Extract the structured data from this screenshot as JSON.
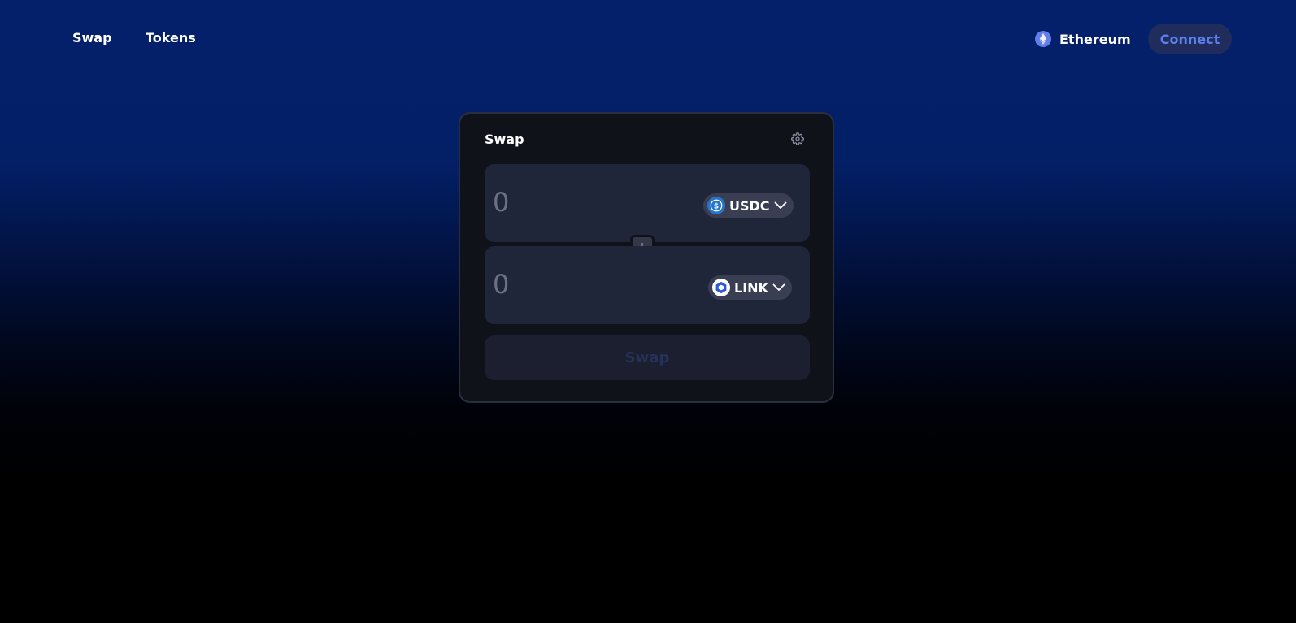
{
  "nav": {
    "items": [
      {
        "label": "Swap"
      },
      {
        "label": "Tokens"
      }
    ]
  },
  "network": {
    "label": "Ethereum",
    "icon": "ethereum-icon",
    "color": "#627eea"
  },
  "connect": {
    "label": "Connect"
  },
  "swap_card": {
    "title": "Swap",
    "settings_icon": "gear-icon",
    "from": {
      "placeholder": "0",
      "value": "",
      "token": "USDC",
      "token_icon": "usdc-icon",
      "token_color": "#2775ca"
    },
    "to": {
      "placeholder": "0",
      "value": "",
      "token": "LINK",
      "token_icon": "link-icon",
      "token_color": "#2a5ada"
    },
    "direction_icon": "arrow-down-icon",
    "submit_label": "Swap"
  },
  "colors": {
    "accent": "#5d80f0",
    "card_bg": "#10121a",
    "input_bg": "#20263a"
  }
}
